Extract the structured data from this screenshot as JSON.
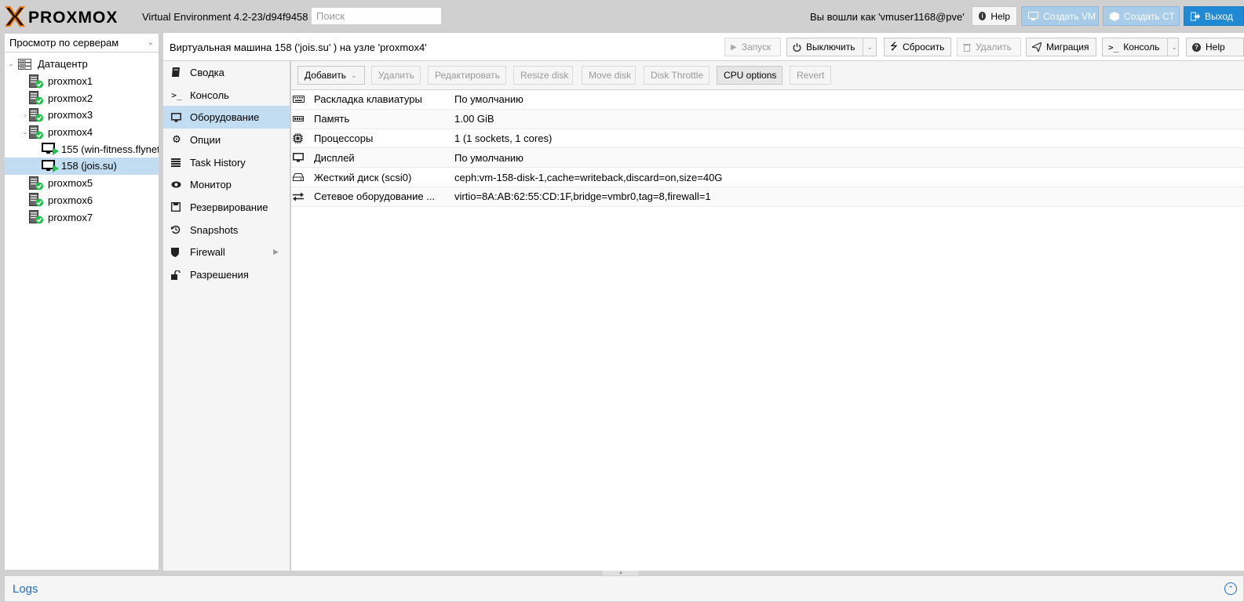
{
  "header": {
    "brand": "PROXMOX",
    "version": "Virtual Environment 4.2-23/d94f9458",
    "search_placeholder": "Поиск",
    "login_text": "Вы вошли как 'vmuser1168@pve'",
    "help_label": "Help",
    "create_vm_label": "Создать VM",
    "create_ct_label": "Создать CT",
    "logout_label": "Выход"
  },
  "tree": {
    "view_label": "Просмотр по серверам",
    "items": [
      {
        "label": "Датацентр"
      },
      {
        "label": "proxmox1"
      },
      {
        "label": "proxmox2"
      },
      {
        "label": "proxmox3"
      },
      {
        "label": "proxmox4"
      },
      {
        "label": "155 (win-fitness.flynet"
      },
      {
        "label": "158 (jois.su)"
      },
      {
        "label": "proxmox5"
      },
      {
        "label": "proxmox6"
      },
      {
        "label": "proxmox7"
      }
    ]
  },
  "titlebar": {
    "title": "Виртуальная машина 158 ('jois.su' ) на узле 'proxmox4'",
    "start_label": "Запуск",
    "shutdown_label": "Выключить",
    "reset_label": "Сбросить",
    "remove_label": "Удалить",
    "migrate_label": "Миграция",
    "console_label": "Консоль",
    "help_label": "Help"
  },
  "nav": {
    "items": [
      {
        "label": "Сводка"
      },
      {
        "label": "Консоль"
      },
      {
        "label": "Оборудование"
      },
      {
        "label": "Опции"
      },
      {
        "label": "Task History"
      },
      {
        "label": "Монитор"
      },
      {
        "label": "Резервирование"
      },
      {
        "label": "Snapshots"
      },
      {
        "label": "Firewall"
      },
      {
        "label": "Разрешения"
      }
    ]
  },
  "toolbar": {
    "add_label": "Добавить",
    "remove_label": "Удалить",
    "edit_label": "Редактировать",
    "resize_label": "Resize disk",
    "move_label": "Move disk",
    "throttle_label": "Disk Throttle",
    "cpu_label": "CPU options",
    "revert_label": "Revert"
  },
  "hardware": [
    {
      "key": "Раскладка клавиатуры",
      "value": "По умолчанию"
    },
    {
      "key": "Память",
      "value": "1.00 GiB"
    },
    {
      "key": "Процессоры",
      "value": "1 (1 sockets, 1 cores)"
    },
    {
      "key": "Дисплей",
      "value": "По умолчанию"
    },
    {
      "key": "Жесткий диск (scsi0)",
      "value": "ceph:vm-158-disk-1,cache=writeback,discard=on,size=40G"
    },
    {
      "key": "Сетевое оборудование ...",
      "value": "virtio=8A:AB:62:55:CD:1F,bridge=vmbr0,tag=8,firewall=1"
    }
  ],
  "logs": {
    "title": "Logs"
  },
  "colors": {
    "accent": "#1f89d4",
    "selection": "#c2ddf2",
    "logo_orange": "#e57000"
  }
}
